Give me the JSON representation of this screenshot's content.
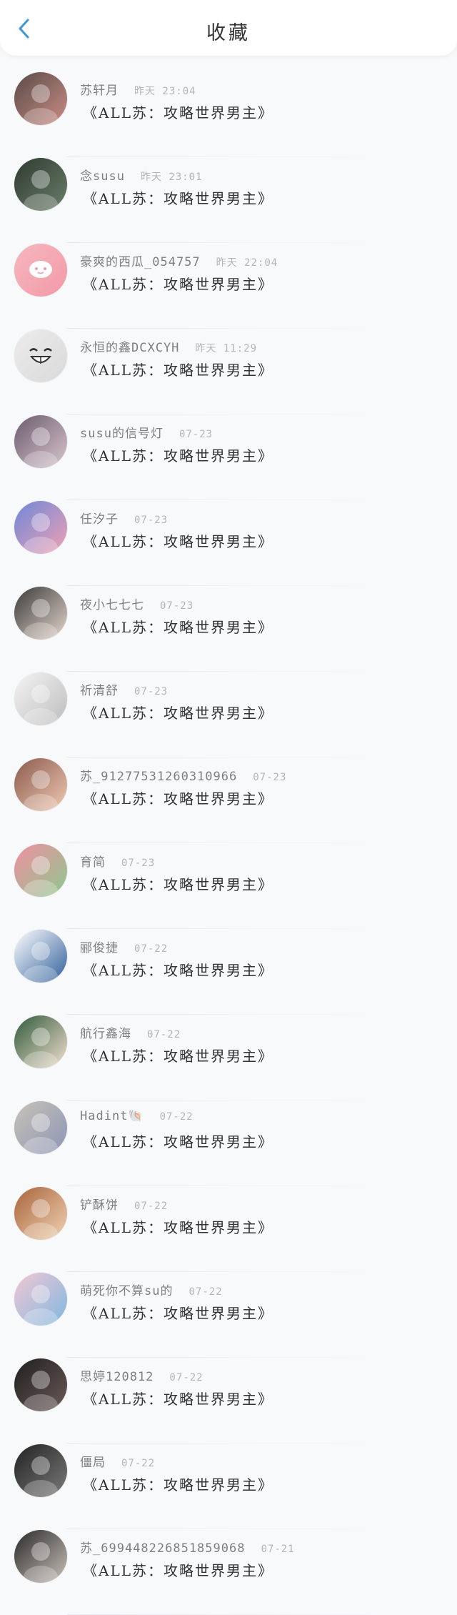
{
  "header": {
    "title": "收藏",
    "back_icon": "chevron-left-icon",
    "accent_color": "#3d97d6"
  },
  "list": {
    "items": [
      {
        "name": "苏轩月",
        "time": "昨天 23:04",
        "title": "《ALL苏：攻略世界男主》",
        "avatar": "avatar-photo-icon",
        "c1": "#5a4a48",
        "c2": "#c98d84"
      },
      {
        "name": "念susu",
        "time": "昨天 23:01",
        "title": "《ALL苏：攻略世界男主》",
        "avatar": "avatar-photo-icon",
        "c1": "#2f3a30",
        "c2": "#6a7e6a"
      },
      {
        "name": "豪爽的西瓜_054757",
        "time": "昨天 22:04",
        "title": "《ALL苏：攻略世界男主》",
        "avatar": "default-avatar-icon",
        "c1": "#f6b7bf",
        "c2": "#f29aa6"
      },
      {
        "name": "永恒的鑫DCXCYH",
        "time": "昨天 11:29",
        "title": "《ALL苏：攻略世界男主》",
        "avatar": "smile-face-icon",
        "c1": "#ececec",
        "c2": "#d9d9d9"
      },
      {
        "name": "susu的信号灯",
        "time": "07-23",
        "title": "《ALL苏：攻略世界男主》",
        "avatar": "avatar-photo-icon",
        "c1": "#6b5b6f",
        "c2": "#d8c6cc"
      },
      {
        "name": "任汐子",
        "time": "07-23",
        "title": "《ALL苏：攻略世界男主》",
        "avatar": "avatar-photo-icon",
        "c1": "#6e88d9",
        "c2": "#f0a0b4"
      },
      {
        "name": "夜小七七七",
        "time": "07-23",
        "title": "《ALL苏：攻略世界男主》",
        "avatar": "avatar-photo-icon",
        "c1": "#3a3a3a",
        "c2": "#e5d6cc"
      },
      {
        "name": "祈清舒",
        "time": "07-23",
        "title": "《ALL苏：攻略世界男主》",
        "avatar": "avatar-photo-icon",
        "c1": "#f4f4f4",
        "c2": "#bdbdbd"
      },
      {
        "name": "苏_91277531260310966",
        "time": "07-23",
        "title": "《ALL苏：攻略世界男主》",
        "avatar": "avatar-photo-icon",
        "c1": "#8a5a4c",
        "c2": "#f0c9b3"
      },
      {
        "name": "育简",
        "time": "07-23",
        "title": "《ALL苏：攻略世界男主》",
        "avatar": "avatar-photo-icon",
        "c1": "#f08fa0",
        "c2": "#8ec88e"
      },
      {
        "name": "郦俊捷",
        "time": "07-22",
        "title": "《ALL苏：攻略世界男主》",
        "avatar": "avatar-photo-icon",
        "c1": "#ffffff",
        "c2": "#2f5f9a"
      },
      {
        "name": "航行鑫海",
        "time": "07-22",
        "title": "《ALL苏：攻略世界男主》",
        "avatar": "avatar-photo-icon",
        "c1": "#2f5a3a",
        "c2": "#f3e0d0"
      },
      {
        "name": "Hadint🐚",
        "time": "07-22",
        "title": "《ALL苏：攻略世界男主》",
        "avatar": "avatar-photo-icon",
        "c1": "#c8c2b8",
        "c2": "#8c96b4"
      },
      {
        "name": "铲酥饼",
        "time": "07-22",
        "title": "《ALL苏：攻略世界男主》",
        "avatar": "avatar-photo-icon",
        "c1": "#a8643a",
        "c2": "#f1d2b4"
      },
      {
        "name": "萌死你不算su的",
        "time": "07-22",
        "title": "《ALL苏：攻略世界男主》",
        "avatar": "avatar-photo-icon",
        "c1": "#f3c7d4",
        "c2": "#7fb8e0"
      },
      {
        "name": "思婷120812",
        "time": "07-22",
        "title": "《ALL苏：攻略世界男主》",
        "avatar": "avatar-photo-icon",
        "c1": "#1f1f1f",
        "c2": "#6b5a58"
      },
      {
        "name": "僵局",
        "time": "07-22",
        "title": "《ALL苏：攻略世界男主》",
        "avatar": "avatar-photo-icon",
        "c1": "#222222",
        "c2": "#7a7a7a"
      },
      {
        "name": "苏_699448226851859068",
        "time": "07-21",
        "title": "《ALL苏：攻略世界男主》",
        "avatar": "avatar-photo-icon",
        "c1": "#2a2a2a",
        "c2": "#c9c0b8"
      }
    ]
  }
}
